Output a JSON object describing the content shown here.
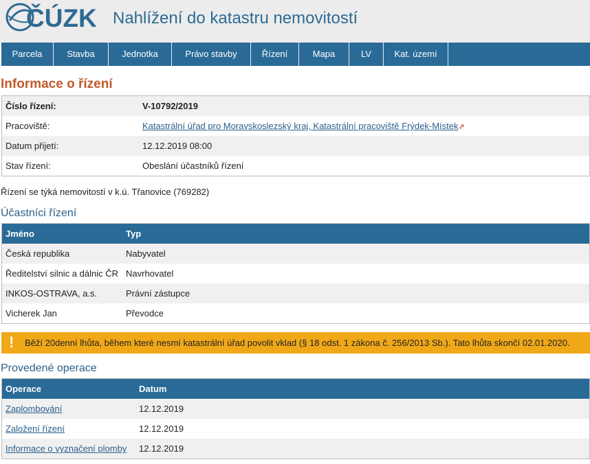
{
  "header": {
    "logo_text": "ČÚZK",
    "app_title": "Nahlížení do katastru nemovitostí"
  },
  "nav": [
    "Parcela",
    "Stavba",
    "Jednotka",
    "Právo stavby",
    "Řízení",
    "Mapa",
    "LV",
    "Kat. území"
  ],
  "main_title": "Informace o řízení",
  "info": {
    "number_label": "Číslo řízení:",
    "number_value": "V-10792/2019",
    "workplace_label": "Pracoviště:",
    "workplace_value": "Katastrální úřad pro Moravskoslezský kraj, Katastrální pracoviště Frýdek-Místek",
    "date_label": "Datum přijetí:",
    "date_value": "12.12.2019 08:00",
    "state_label": "Stav řízení:",
    "state_value": "Obeslání účastníků řízení"
  },
  "note": "Řízení se týká nemovitostí v k.ú. Třanovice (769282)",
  "participants": {
    "title": "Účastníci řízení",
    "col_name": "Jméno",
    "col_type": "Typ",
    "rows": [
      {
        "name": "Česká republika",
        "type": "Nabyvatel"
      },
      {
        "name": "Ředitelství silnic a dálnic ČR",
        "type": "Navrhovatel"
      },
      {
        "name": "INKOS-OSTRAVA, a.s.",
        "type": "Právní zástupce"
      },
      {
        "name": "Vicherek Jan",
        "type": "Převodce"
      }
    ]
  },
  "warning": {
    "icon": "!",
    "text": "Běží 20denní lhůta, během které nesmí katastrální úřad povolit vklad (§ 18 odst. 1 zákona č. 256/2013 Sb.). Tato lhůta skončí 02.01.2020."
  },
  "operations": {
    "title": "Provedené operace",
    "col_op": "Operace",
    "col_date": "Datum",
    "rows": [
      {
        "op": "Zaplombování",
        "date": "12.12.2019"
      },
      {
        "op": "Založení řízení",
        "date": "12.12.2019"
      },
      {
        "op": "Informace o vyznačení plomby",
        "date": "12.12.2019"
      }
    ]
  },
  "colors": {
    "nav_bg": "#2a6a97",
    "title_orange": "#c15a2a",
    "warning_bg": "#f0a818"
  }
}
